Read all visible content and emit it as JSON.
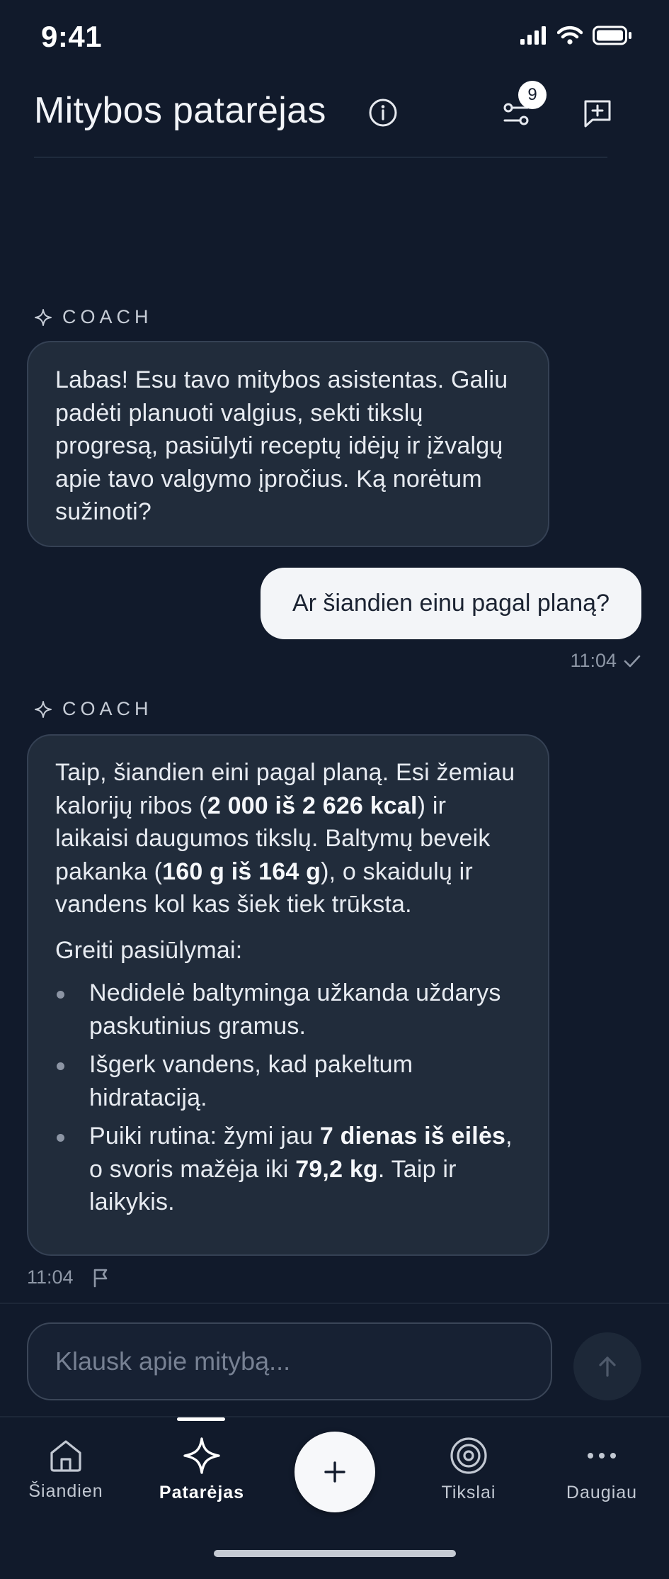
{
  "status_bar": {
    "time": "9:41"
  },
  "header": {
    "title": "Mitybos patarėjas",
    "filter_badge_count": "9",
    "icons": [
      "info-icon",
      "filter-icon",
      "new-chat-icon"
    ]
  },
  "chat": {
    "coach_label": "COACH",
    "messages": [
      {
        "role": "coach",
        "text": "Labas! Esu tavo mitybos asistentas. Galiu padėti planuoti valgius, sekti tikslų progresą, pasiūlyti receptų idėjų ir įžvalgų apie tavo valgymo įpročius. Ką norėtum sužinoti?"
      },
      {
        "role": "user",
        "text": "Ar šiandien einu pagal planą?",
        "time": "11:04",
        "status": "read"
      },
      {
        "role": "coach",
        "intro": {
          "t1": "Taip, šiandien eini pagal planą. Esi žemiau kalorijų ribos (",
          "b1": "2 000 iš 2 626 kcal",
          "t2": ") ir laikaisi daugumos tikslų. Baltymų beveik pakanka (",
          "b2": "160 g iš 164 g",
          "t3": "), o skaidulų ir vandens kol kas šiek tiek trūksta."
        },
        "tips_heading": "Greiti pasiūlymai:",
        "tips": [
          {
            "text": "Nedidelė baltyminga užkanda uždarys paskutinius gramus."
          },
          {
            "text": "Išgerk vandens, kad pakeltum hidrataciją."
          },
          {
            "t1": "Puiki rutina: žymi jau ",
            "b1": "7 dienas iš eilės",
            "t2": ", o svoris mažėja iki ",
            "b2": "79,2 kg",
            "t3": ". Taip ir laikykis."
          }
        ],
        "time": "11:04"
      }
    ]
  },
  "composer": {
    "placeholder": "Klausk apie mitybą..."
  },
  "bottom_nav": {
    "items": [
      {
        "label": "Šiandien",
        "icon": "home-icon",
        "active": false
      },
      {
        "label": "Patarėjas",
        "icon": "sparkle-icon",
        "active": true
      },
      {
        "label": "",
        "icon": "plus-icon",
        "active": false
      },
      {
        "label": "Tikslai",
        "icon": "target-icon",
        "active": false
      },
      {
        "label": "Daugiau",
        "icon": "more-icon",
        "active": false
      }
    ]
  }
}
